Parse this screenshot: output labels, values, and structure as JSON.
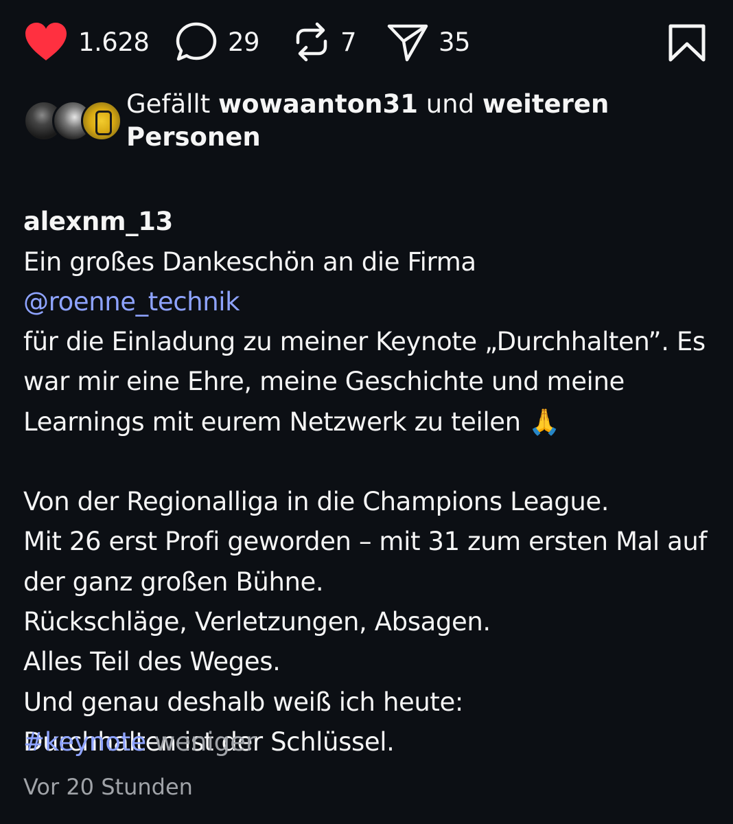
{
  "actions": {
    "likes": "1.628",
    "comments": "29",
    "reposts": "7",
    "shares": "35",
    "like_color": "#ff3040"
  },
  "liked_by": {
    "prefix": "Gefällt",
    "user": "wowaanton31",
    "connector": "und",
    "others": "weiteren Personen"
  },
  "caption": {
    "username": "alexnm_13",
    "text_before_mention": "Ein großes Dankeschön an die Firma",
    "mention": "@roenne_technik",
    "text_after_mention": "für die Einladung zu meiner Keynote „Durchhalten”. Es war mir eine Ehre, meine Geschichte und meine Learnings mit eurem Netzwerk zu teilen 🙏",
    "paragraph2": "Von der Regionalliga in die Champions League.\nMit 26 erst Profi geworden – mit 31 zum ersten Mal auf der ganz großen Bühne.\nRückschläge, Verletzungen, Absagen.\nAlles Teil des Weges.\nUnd genau deshalb weiß ich heute:\nDurchhalten ist der Schlüssel.",
    "hashtag": "#keynote",
    "less_label": "weniger"
  },
  "timestamp": "Vor 20 Stunden",
  "colors": {
    "background": "#0c0f14",
    "link": "#8ea3ff",
    "muted": "#a0a3a8"
  }
}
